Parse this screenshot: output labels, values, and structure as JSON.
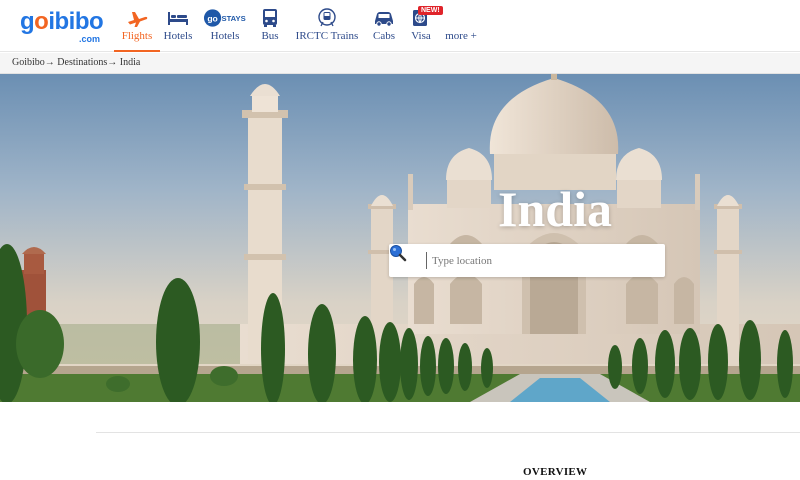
{
  "brand": {
    "logo_main": "goibibo",
    "logo_sub": ".com",
    "primary_color": "#2276e3",
    "accent_color": "#f26522"
  },
  "nav": {
    "items": [
      {
        "label": "Flights",
        "icon": "airplane-icon",
        "active": true
      },
      {
        "label": "Hotels",
        "icon": "bed-icon"
      },
      {
        "label": "Hotels",
        "icon": "gostays-icon",
        "icon_text": "STAYS"
      },
      {
        "label": "Bus",
        "icon": "bus-icon"
      },
      {
        "label": "IRCTC Trains",
        "icon": "train-icon"
      },
      {
        "label": "Cabs",
        "icon": "car-icon"
      },
      {
        "label": "Visa",
        "icon": "globe-icon",
        "badge": "NEW!"
      },
      {
        "label": "more +"
      }
    ]
  },
  "breadcrumb": {
    "text": "Goibibo→ Destinations→ India"
  },
  "hero": {
    "title": "India",
    "search_placeholder": "Type location"
  },
  "content": {
    "section_title": "OVERVIEW"
  }
}
